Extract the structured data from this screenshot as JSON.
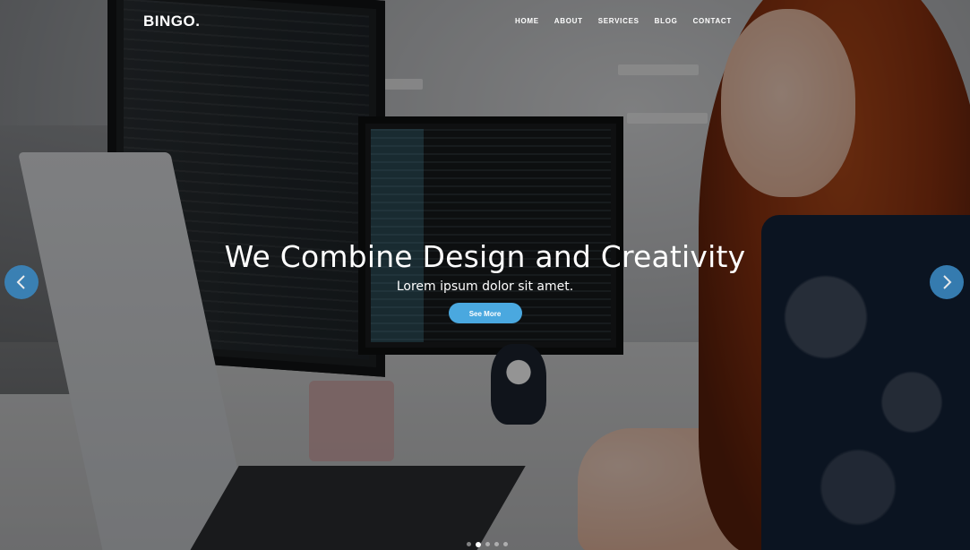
{
  "header": {
    "logo": "BINGO.",
    "nav": [
      "HOME",
      "ABOUT",
      "SERVICES",
      "BLOG",
      "CONTACT"
    ]
  },
  "hero": {
    "title": "We Combine Design and Creativity",
    "subtitle": "Lorem ipsum dolor sit amet.",
    "button_label": "See More"
  },
  "carousel": {
    "prev_icon": "chevron-left-icon",
    "next_icon": "chevron-right-icon",
    "dot_count": 5,
    "active_dot": 2
  },
  "colors": {
    "accent": "#4aa8df",
    "arrow": "#3a87bf",
    "text": "#ffffff"
  }
}
